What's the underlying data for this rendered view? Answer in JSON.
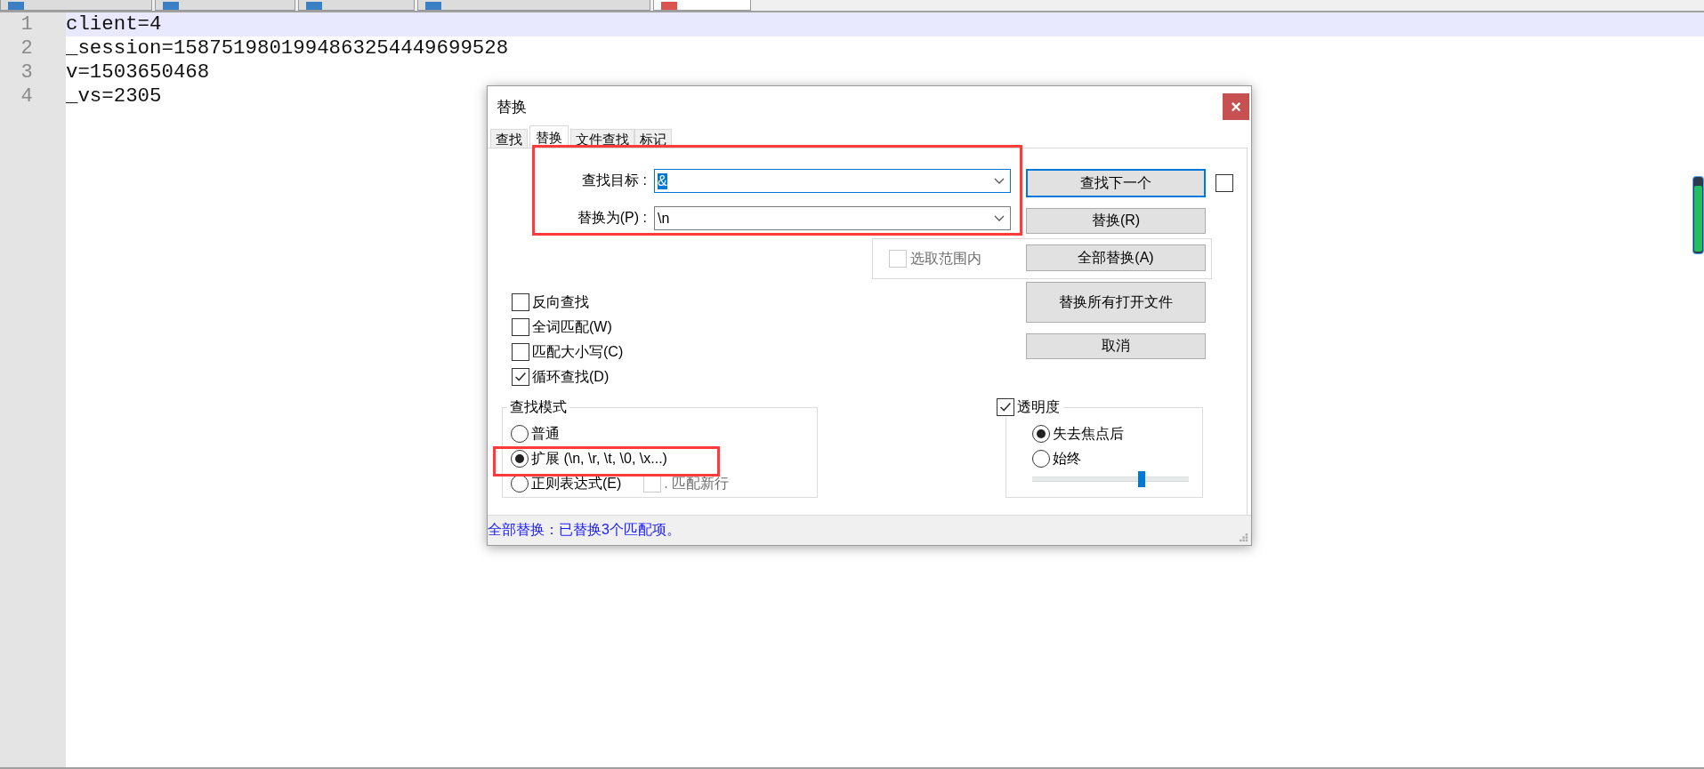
{
  "file_tabs": [
    {
      "selected": false,
      "color": "#3b7fc4"
    },
    {
      "selected": false,
      "color": "#3b7fc4"
    },
    {
      "selected": false,
      "color": "#3b7fc4"
    },
    {
      "selected": false,
      "color": "#3b7fc4"
    },
    {
      "selected": true,
      "color": "#d9534f"
    }
  ],
  "editor": {
    "lines": [
      {
        "number": "1",
        "text": "client=4",
        "current": true
      },
      {
        "number": "2",
        "text": "_session=1587519801994863254449699528",
        "current": false
      },
      {
        "number": "3",
        "text": "v=1503650468",
        "current": false
      },
      {
        "number": "4",
        "text": "_vs=2305",
        "current": false
      }
    ]
  },
  "dialog": {
    "title": "替换",
    "close": "×",
    "tabs": [
      {
        "label": "查找",
        "selected": false
      },
      {
        "label": "替换",
        "selected": true
      },
      {
        "label": "文件查找",
        "selected": false
      },
      {
        "label": "标记",
        "selected": false
      }
    ],
    "fields": [
      {
        "label": "查找目标 :",
        "value": "&",
        "focused": true,
        "text_selected": true
      },
      {
        "label": "替换为(P) :",
        "value": "\\n",
        "focused": false,
        "text_selected": false
      }
    ],
    "buttons": [
      {
        "label": "查找下一个",
        "default": true
      },
      {
        "label": "替换(R)",
        "default": false
      },
      {
        "label": "全部替换(A)",
        "default": false
      },
      {
        "label": "替换所有打开文件",
        "default": false
      },
      {
        "label": "取消",
        "default": false
      }
    ],
    "side_checkbox": {
      "checked": false
    },
    "in_selection": {
      "label": "选取范围内",
      "checked": false,
      "disabled": true
    },
    "options": [
      {
        "label": "反向查找",
        "checked": false
      },
      {
        "label": "全词匹配(W)",
        "checked": false
      },
      {
        "label": "匹配大小写(C)",
        "checked": false
      },
      {
        "label": "循环查找(D)",
        "checked": true
      }
    ],
    "search_mode": {
      "title": "查找模式",
      "options": [
        {
          "label": "普通",
          "selected": false
        },
        {
          "label": "扩展 (\\n, \\r, \\t, \\0, \\x...)",
          "selected": true
        },
        {
          "label": "正则表达式(E)",
          "selected": false
        }
      ],
      "dot_newline": {
        "label": ". 匹配新行",
        "checked": false,
        "disabled": true
      }
    },
    "transparency": {
      "label": "透明度",
      "checked": true,
      "options": [
        {
          "label": "失去焦点后",
          "selected": true
        },
        {
          "label": "始终",
          "selected": false
        }
      ],
      "level": 0.7
    },
    "status": "全部替换：已替换3个匹配项。"
  }
}
